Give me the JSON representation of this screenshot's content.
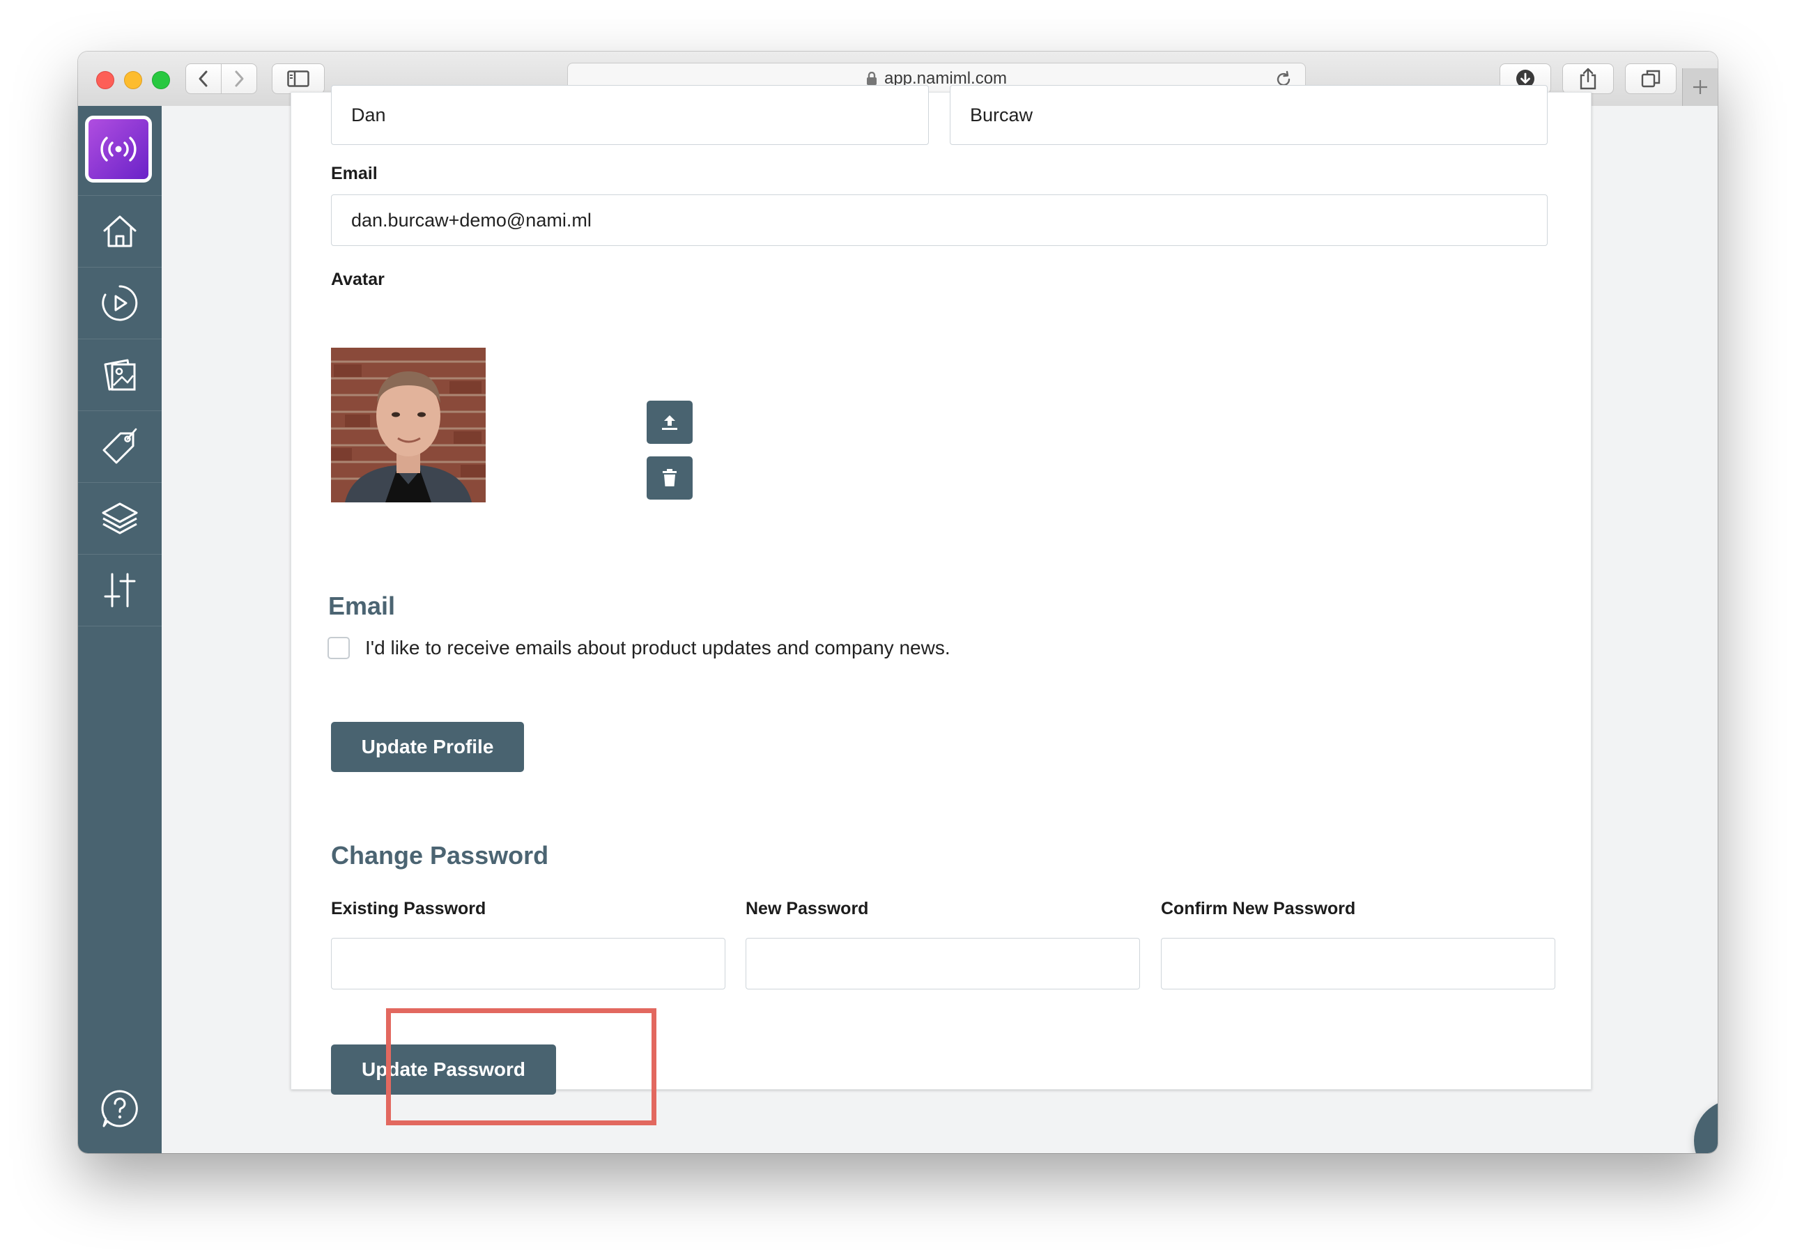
{
  "browser": {
    "url": "app.namiml.com"
  },
  "profile": {
    "first_name_value": "Dan",
    "last_name_value": "Burcaw",
    "email_label": "Email",
    "email_value": "dan.burcaw+demo@nami.ml",
    "avatar_label": "Avatar"
  },
  "email_prefs": {
    "title": "Email",
    "checkbox_label": "I'd like to receive emails about product updates and company news.",
    "checked": false
  },
  "update_profile_label": "Update Profile",
  "password": {
    "title": "Change Password",
    "existing_label": "Existing Password",
    "new_label": "New Password",
    "confirm_label": "Confirm New Password",
    "existing_value": "",
    "new_value": "",
    "confirm_value": "",
    "submit_label": "Update Password"
  },
  "sidebar": {
    "items": [
      "home",
      "play",
      "images",
      "tag",
      "layers",
      "sliders"
    ],
    "help": "help"
  },
  "colors": {
    "sidebar": "#496370",
    "accent_button": "#496370",
    "section_title": "#4b6472",
    "highlight": "#e2685f",
    "logo_gradient": [
      "#b04ee0",
      "#6a22c8"
    ]
  }
}
